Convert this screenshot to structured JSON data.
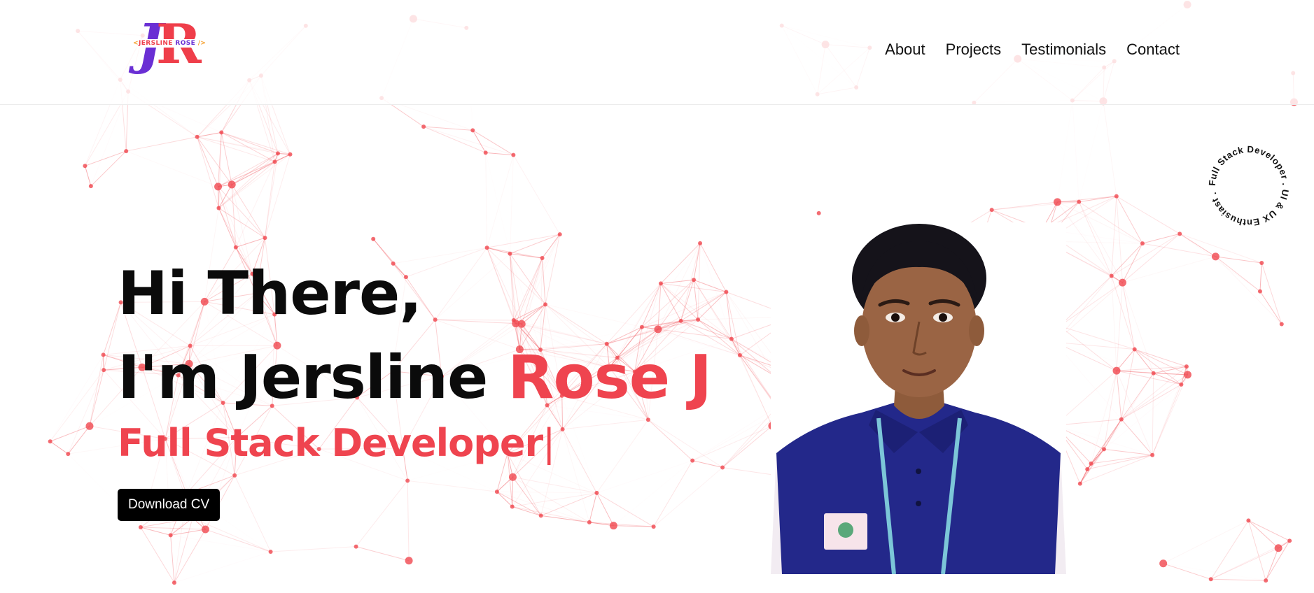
{
  "logo": {
    "letters": [
      "J",
      "R"
    ],
    "tag_open": "<",
    "tag_name_1": "JERSLINE",
    "tag_name_2": "ROSE",
    "tag_close": "/>"
  },
  "nav": {
    "items": [
      {
        "label": "About"
      },
      {
        "label": "Projects"
      },
      {
        "label": "Testimonials"
      },
      {
        "label": "Contact"
      }
    ]
  },
  "hero": {
    "greeting": "Hi There,",
    "intro_prefix": "I'm Jersline ",
    "intro_highlight": "Rose J",
    "role": "Full Stack Developer",
    "cursor": "|",
    "download_label": "Download CV"
  },
  "badge": {
    "circular_text": "Full Stack Developer . UI & UX Enthusiast . "
  },
  "colors": {
    "accent": "#ef444f",
    "network_red": "#f0474f",
    "logo_purple": "#6a2fd4",
    "logo_orange": "#f59e2a",
    "button_bg": "#000000",
    "shirt_blue": "#23288a"
  }
}
